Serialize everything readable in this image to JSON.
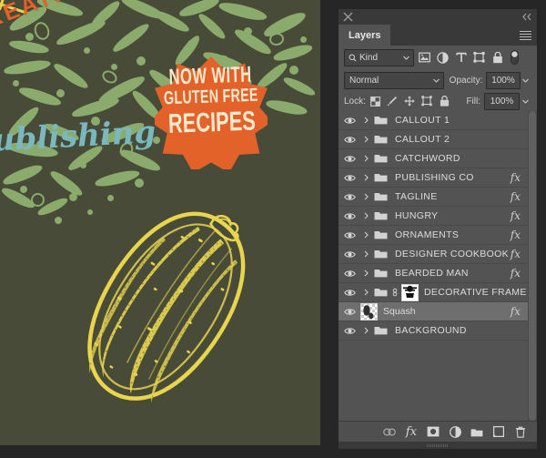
{
  "panel": {
    "close_icon": "close-icon",
    "collapse_icon": "collapse-double-chevron-icon",
    "menu_icon": "panel-menu-icon",
    "tabs": [
      {
        "label": "Layers",
        "active": true
      }
    ],
    "filter": {
      "search_icon": "search-icon",
      "kind_label": "Kind",
      "chevron_icon": "chevron-down-icon",
      "icons": [
        "pixel-layer-filter-icon",
        "adjustment-layer-filter-icon",
        "type-layer-filter-icon",
        "shape-layer-filter-icon",
        "smart-object-filter-icon"
      ],
      "toggle_icon": "filter-toggle-switch"
    },
    "blend": {
      "mode": "Normal",
      "chevron_icon": "chevron-down-icon",
      "opacity_label": "Opacity:",
      "opacity_value": "100%",
      "opacity_chevron": "chevron-down-icon"
    },
    "lock": {
      "label": "Lock:",
      "icons": [
        "lock-transparent-pixels-icon",
        "lock-image-pixels-brush-icon",
        "lock-position-move-icon",
        "lock-artboard-nesting-icon",
        "lock-all-padlock-icon"
      ],
      "fill_label": "Fill:",
      "fill_value": "100%",
      "fill_chevron": "chevron-down-icon"
    },
    "layers": [
      {
        "name": "CALLOUT 1",
        "type": "group",
        "visible": true,
        "fx": false,
        "selected": false,
        "linked": false
      },
      {
        "name": "CALLOUT 2",
        "type": "group",
        "visible": true,
        "fx": false,
        "selected": false,
        "linked": false
      },
      {
        "name": "CATCHWORD",
        "type": "group",
        "visible": true,
        "fx": false,
        "selected": false,
        "linked": false
      },
      {
        "name": "PUBLISHING CO",
        "type": "group",
        "visible": true,
        "fx": true,
        "selected": false,
        "linked": false
      },
      {
        "name": "TAGLINE",
        "type": "group",
        "visible": true,
        "fx": true,
        "selected": false,
        "linked": false
      },
      {
        "name": "HUNGRY",
        "type": "group",
        "visible": true,
        "fx": true,
        "selected": false,
        "linked": false
      },
      {
        "name": "ORNAMENTS",
        "type": "group",
        "visible": true,
        "fx": true,
        "selected": false,
        "linked": false
      },
      {
        "name": "DESIGNER COOKBOOK",
        "type": "group",
        "visible": true,
        "fx": true,
        "selected": false,
        "linked": false
      },
      {
        "name": "BEARDED MAN",
        "type": "group",
        "visible": true,
        "fx": true,
        "selected": false,
        "linked": false
      },
      {
        "name": "DECORATIVE FRAME",
        "type": "group",
        "visible": true,
        "fx": false,
        "selected": false,
        "linked": true
      },
      {
        "name": "Squash",
        "type": "pixel",
        "visible": true,
        "fx": true,
        "selected": true,
        "linked": false
      },
      {
        "name": "BACKGROUND",
        "type": "group",
        "visible": true,
        "fx": false,
        "selected": false,
        "linked": false
      }
    ],
    "footer_icons": [
      "link-layers-icon",
      "add-layer-style-fx-icon",
      "add-layer-mask-icon",
      "new-adjustment-layer-icon",
      "new-group-icon",
      "new-layer-icon",
      "delete-layer-trash-icon"
    ],
    "scrollbar_icon": "vertical-scrollbar"
  },
  "artwork": {
    "heading": "CREATIVE PEOPLE",
    "subheading": "Publishing Co.",
    "badge": {
      "line1": "NOW WITH",
      "line2": "GLUTEN FREE",
      "line3": "RECIPES"
    },
    "illustration": "squash-illustration",
    "colors": {
      "canvas_green": "#474b38",
      "leaf_green": "#8aab6c",
      "orange": "#e2622a",
      "cream": "#fbe9cf",
      "teal": "#79b8bd",
      "squash_yellow": "#e8d44d"
    }
  }
}
